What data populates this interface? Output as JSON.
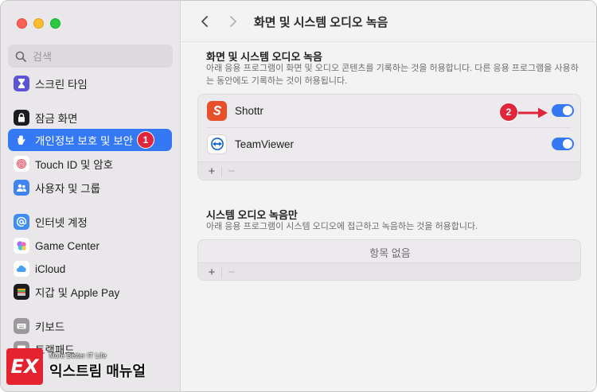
{
  "window": {
    "title": "화면 및 시스템 오디오 녹음"
  },
  "sidebar": {
    "search_placeholder": "검색",
    "items": [
      {
        "label": "스크린 타임",
        "icon": "hourglass-icon"
      },
      {
        "label": "잠금 화면",
        "icon": "lock-screen-icon"
      },
      {
        "label": "개인정보 보호 및 보안",
        "icon": "hand-icon",
        "active": true,
        "badge": "1"
      },
      {
        "label": "Touch ID 및 암호",
        "icon": "fingerprint-icon"
      },
      {
        "label": "사용자 및 그룹",
        "icon": "users-icon"
      },
      {
        "label": "인터넷 계정",
        "icon": "at-icon"
      },
      {
        "label": "Game Center",
        "icon": "game-center-icon"
      },
      {
        "label": "iCloud",
        "icon": "icloud-icon"
      },
      {
        "label": "지갑 및 Apple Pay",
        "icon": "wallet-icon"
      },
      {
        "label": "키보드",
        "icon": "keyboard-icon"
      },
      {
        "label": "트랙패드",
        "icon": "trackpad-icon"
      }
    ]
  },
  "watermark": {
    "sub": "More Better IT Life",
    "main": "익스트림 매뉴얼",
    "logo": "EX"
  },
  "main": {
    "title": "화면 및 시스템 오디오 녹음",
    "section1": {
      "title": "화면 및 시스템 오디오 녹음",
      "desc": "아래 응용 프로그램이 화면 및 오디오 콘텐츠를 기록하는 것을 허용합니다. 다른 응용 프로그램을 사용하는 동안에도 기록하는 것이 허용됩니다.",
      "apps": [
        {
          "name": "Shottr",
          "enabled": true,
          "badge": "2"
        },
        {
          "name": "TeamViewer",
          "enabled": true
        }
      ],
      "add": "+",
      "remove": "−"
    },
    "section2": {
      "title": "시스템 오디오 녹음만",
      "desc": "아래 응용 프로그램이 시스템 오디오에 접근하고 녹음하는 것을 허용합니다.",
      "empty": "항목 없음",
      "add": "+",
      "remove": "−"
    }
  },
  "colors": {
    "accent": "#3478f6",
    "badge": "#e0263b",
    "shottr": "#e8502a",
    "teamviewer": "#0e5dd8"
  }
}
